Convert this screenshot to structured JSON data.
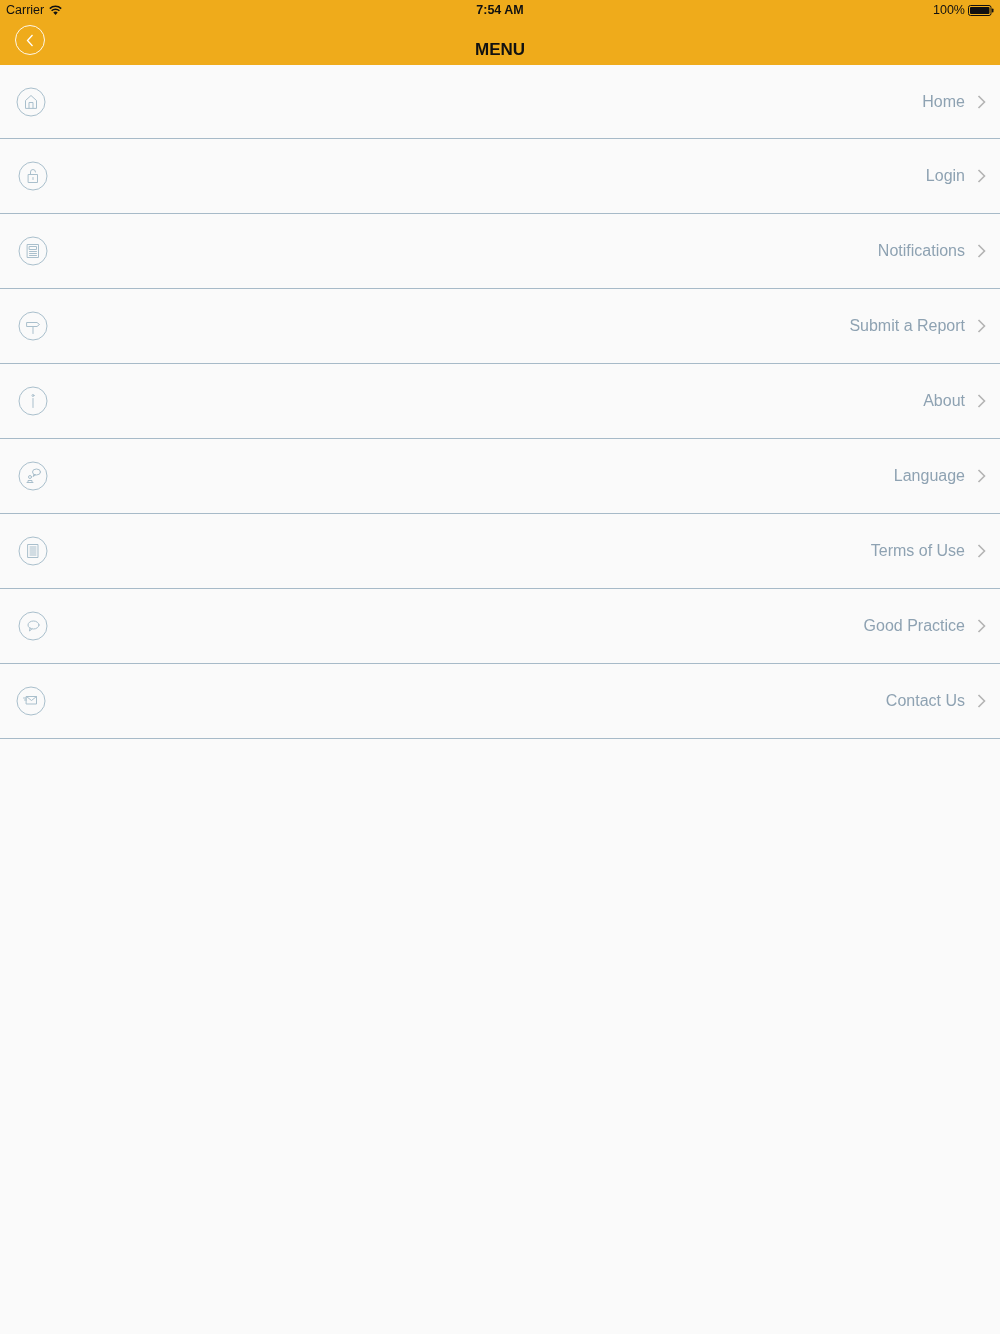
{
  "status_bar": {
    "carrier": "Carrier",
    "time": "7:54 AM",
    "battery": "100%"
  },
  "nav_bar": {
    "title": "MENU"
  },
  "menu": {
    "items": [
      {
        "label": "Home"
      },
      {
        "label": "Login"
      },
      {
        "label": "Notifications"
      },
      {
        "label": "Submit a Report"
      },
      {
        "label": "About"
      },
      {
        "label": "Language"
      },
      {
        "label": "Terms of Use"
      },
      {
        "label": "Good Practice"
      },
      {
        "label": "Contact Us"
      }
    ]
  }
}
